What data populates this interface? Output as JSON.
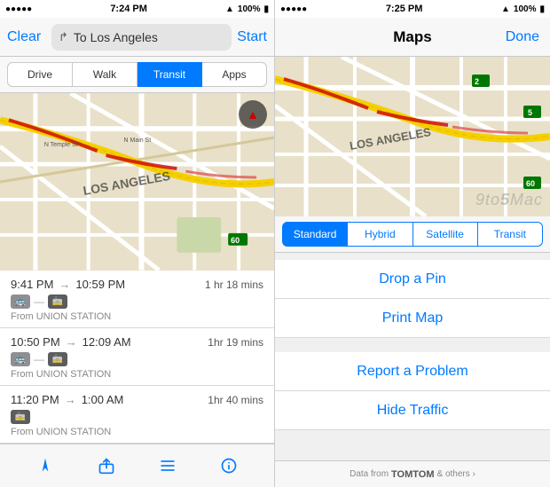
{
  "left": {
    "status": {
      "time": "7:24 PM",
      "signal": "●●●●●",
      "wifi": "▲",
      "battery": "100%"
    },
    "nav": {
      "clear_label": "Clear",
      "destination": "To Los Angeles",
      "start_label": "Start"
    },
    "transport_tabs": [
      {
        "label": "Drive",
        "active": false
      },
      {
        "label": "Walk",
        "active": false
      },
      {
        "label": "Transit",
        "active": true
      },
      {
        "label": "Apps",
        "active": false
      }
    ],
    "transit_items": [
      {
        "start": "9:41 PM",
        "end": "10:59 PM",
        "duration": "1 hr 18 mins",
        "icons": [
          "bus",
          "line",
          "tram"
        ],
        "from": "From UNION STATION"
      },
      {
        "start": "10:50 PM",
        "end": "12:09 AM",
        "duration": "1hr 19 mins",
        "icons": [
          "bus",
          "line",
          "tram"
        ],
        "from": "From UNION STATION"
      },
      {
        "start": "11:20 PM",
        "end": "1:00 AM",
        "duration": "1hr 40 mins",
        "icons": [
          "tram"
        ],
        "from": "From UNION STATION"
      }
    ],
    "bottom_icons": [
      "location",
      "share",
      "list",
      "info"
    ]
  },
  "right": {
    "status": {
      "time": "7:25 PM",
      "signal": "●●●●●",
      "wifi": "▲",
      "battery": "100%"
    },
    "nav": {
      "title": "Maps",
      "done_label": "Done"
    },
    "map_tabs": [
      {
        "label": "Standard",
        "active": true
      },
      {
        "label": "Hybrid",
        "active": false
      },
      {
        "label": "Satellite",
        "active": false
      },
      {
        "label": "Transit",
        "active": false
      }
    ],
    "menu_items": [
      {
        "label": "Drop a Pin"
      },
      {
        "label": "Print Map"
      },
      {
        "label": "Report a Problem"
      },
      {
        "label": "Hide Traffic"
      }
    ],
    "footer": {
      "text": "Data from",
      "brand": "TOMTOM",
      "suffix": "& others ›"
    },
    "watermark": "9to5Mac"
  }
}
